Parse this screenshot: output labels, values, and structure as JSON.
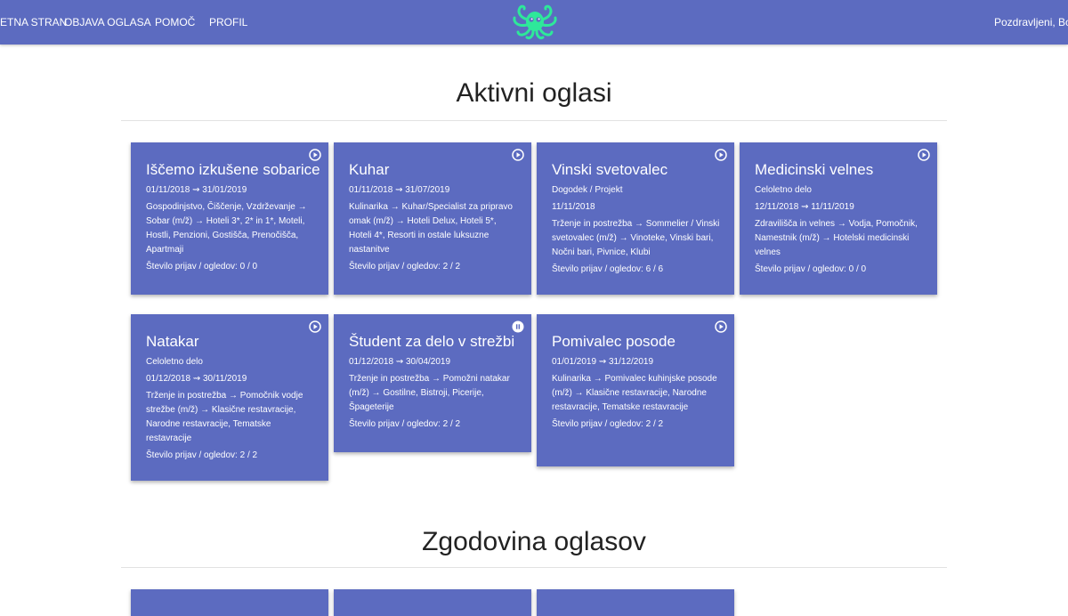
{
  "nav": {
    "items": [
      "ZAČETNA STRAN",
      "OBJAVA OGLASA",
      "POMOČ",
      "PROFIL"
    ],
    "greeting": "Pozdravljeni, Boutique"
  },
  "colors": {
    "primary": "#5c6bc0",
    "logo": "#2ee89a"
  },
  "sections": {
    "active": "Aktivni oglasi",
    "history": "Zgodovina oglasov"
  },
  "cards": [
    {
      "title": "Iščemo izkušene sobarice",
      "state_icon": "play-icon",
      "lines": [
        "01/11/2018 ⇝ 31/01/2019",
        "Gospodinjstvo, Čiščenje, Vzdrževanje → Sobar (m/ž) → Hoteli 3*, 2* in 1*, Moteli, Hostli, Penzioni, Gostišča, Prenočišča, Apartmaji",
        "Število prijav / ogledov: 0 / 0"
      ]
    },
    {
      "title": "Kuhar",
      "state_icon": "play-icon",
      "lines": [
        "01/11/2018 ⇝ 31/07/2019",
        "Kulinarika → Kuhar/Specialist za pripravo omak (m/ž) → Hoteli Delux, Hoteli 5*, Hoteli 4*, Resorti in ostale luksuzne nastanitve",
        "Število prijav / ogledov: 2 / 2"
      ]
    },
    {
      "title": "Vinski svetovalec",
      "state_icon": "play-icon",
      "lines": [
        "Dogodek / Projekt",
        "11/11/2018",
        "Trženje in postrežba → Sommelier / Vinski svetovalec (m/ž) → Vinoteke, Vinski bari, Nočni bari, Pivnice, Klubi",
        "Število prijav / ogledov: 6 / 6"
      ]
    },
    {
      "title": "Medicinski velnes",
      "state_icon": "play-icon",
      "lines": [
        "Celoletno delo",
        "12/11/2018 ⇝ 11/11/2019",
        "Zdravilišča in velnes → Vodja, Pomočnik, Namestnik (m/ž) → Hotelski medicinski velnes",
        "Število prijav / ogledov: 0 / 0"
      ]
    },
    {
      "title": "Natakar",
      "state_icon": "play-icon",
      "lines": [
        "Celoletno delo",
        "01/12/2018 ⇝ 30/11/2019",
        "Trženje in postrežba → Pomočnik vodje strežbe (m/ž) → Klasične restavracije, Narodne restavracije, Tematske restavracije",
        "Število prijav / ogledov: 2 / 2"
      ]
    },
    {
      "title": "Študent za delo v strežbi",
      "state_icon": "pause-icon",
      "lines": [
        "01/12/2018 ⇝ 30/04/2019",
        "Trženje in postrežba → Pomožni natakar (m/ž) → Gostilne, Bistroji, Picerije, Špageterije",
        "Število prijav / ogledov: 2 / 2"
      ]
    },
    {
      "title": "Pomivalec posode",
      "state_icon": "play-icon",
      "lines": [
        "01/01/2019 ⇝ 31/12/2019",
        "Kulinarika → Pomivalec kuhinjske posode (m/ž) → Klasične restavracije, Narodne restavracije, Tematske restavracije",
        "Število prijav / ogledov: 2 / 2"
      ]
    }
  ]
}
